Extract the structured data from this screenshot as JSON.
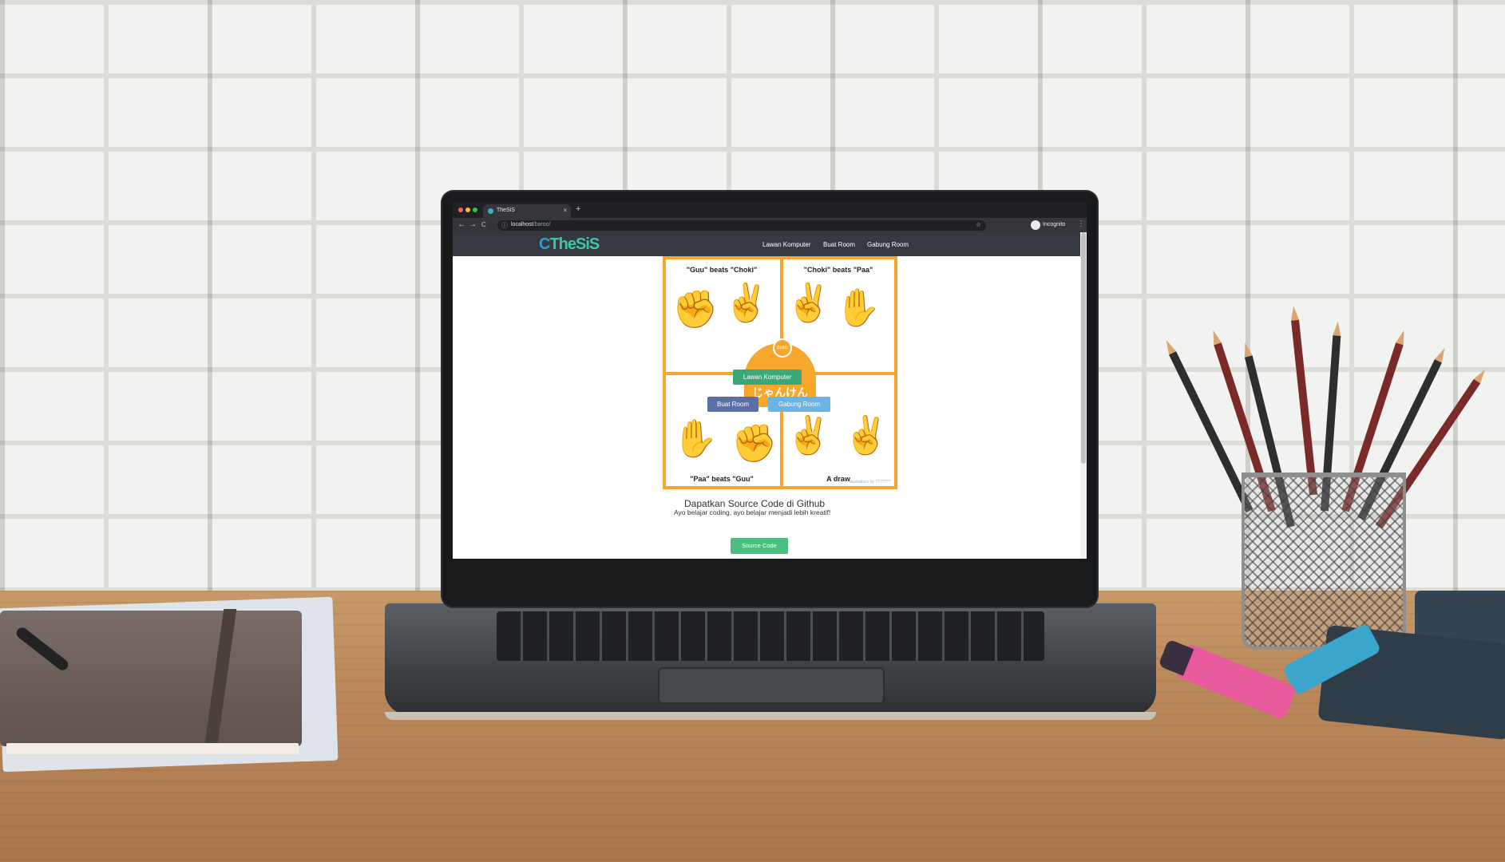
{
  "browser": {
    "tab_title": "TheSiS",
    "tab_close": "×",
    "new_tab": "+",
    "url_host": "localhost",
    "url_path": "/baroo/",
    "profile_label": "Incognito",
    "menu": "⋮",
    "back": "←",
    "forward": "→",
    "reload": "C",
    "info": "ⓘ",
    "star": "☆"
  },
  "site": {
    "logo_prefix": "C",
    "logo_text": "TheSiS",
    "nav": [
      {
        "label": "Lawan Komputer"
      },
      {
        "label": "Buat Room"
      },
      {
        "label": "Gabung Room"
      }
    ]
  },
  "hero": {
    "cells": [
      {
        "label": "\"Guu\" beats \"Choki\"",
        "hands": [
          "✊",
          "✌"
        ]
      },
      {
        "label": "\"Choki\" beats \"Paa\"",
        "hands": [
          "✌",
          "✋"
        ]
      },
      {
        "label": "\"Paa\" beats \"Guu\"",
        "hands": [
          "✋",
          "✊"
        ]
      },
      {
        "label": "A draw",
        "hands": [
          "✌",
          "✌"
        ]
      }
    ],
    "badge_top": "coto",
    "badge_jp": "じゃんけん",
    "buttons": {
      "lawan_komputer": "Lawan Komputer",
      "buat_room": "Buat Room",
      "gabung_room": "Gabung Room"
    },
    "credit": "illustrations by ???????"
  },
  "github": {
    "title": "Dapatkan Source Code di Github",
    "subtitle": "Ayo belajar coding, ayo belajar menjadi lebih kreatif!",
    "button": "Source Code"
  },
  "colors": {
    "accent_orange": "#f6a72c",
    "nav_bg": "#343a40",
    "btn_green": "#4bbf82",
    "btn_navy": "#5a6fa6",
    "btn_blue": "#6cb3e6",
    "btn_teal": "#3aa879"
  }
}
